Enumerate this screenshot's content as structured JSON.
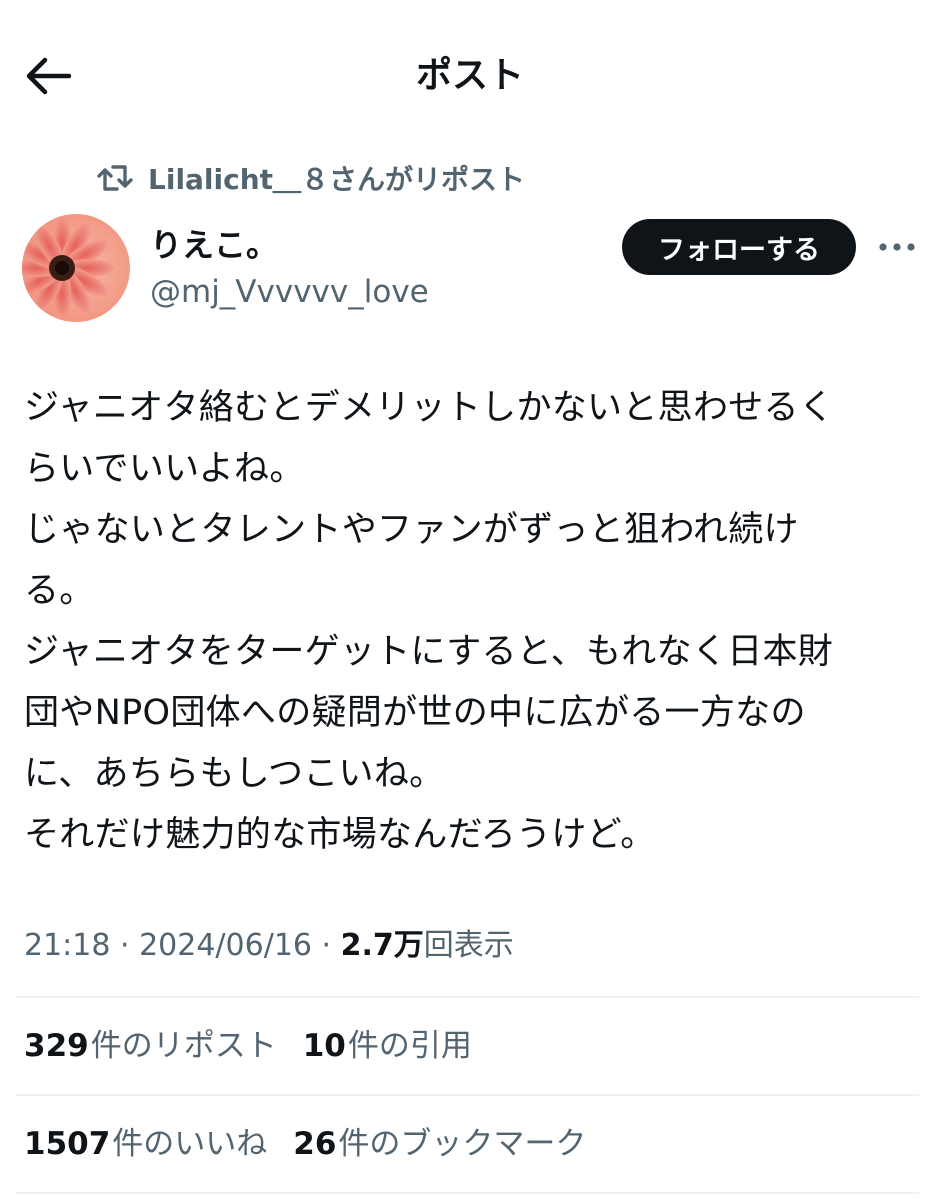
{
  "header": {
    "title": "ポスト",
    "back_icon": "arrow-left-icon"
  },
  "repost": {
    "icon": "retweet-icon",
    "text": "Lilalicht＿８さんがリポスト"
  },
  "author": {
    "display_name": "りえこ。",
    "handle": "@mj_Vvvvvv_love",
    "avatar_icon": "flower-avatar"
  },
  "actions": {
    "follow_label": "フォローする",
    "more_icon": "more-horizontal-icon"
  },
  "tweet": {
    "lines": [
      "ジャニオタ絡むとデメリットしかないと思わせるく",
      "らいでいいよね。",
      "じゃないとタレントやファンがずっと狙われ続け",
      "る。",
      "ジャニオタをターゲットにすると、もれなく日本財",
      "団やNPO団体への疑問が世の中に広がる一方なの",
      "に、あちらもしつこいね。",
      "それだけ魅力的な市場なんだろうけど。"
    ]
  },
  "meta": {
    "time": "21:18",
    "separator": " · ",
    "date": "2024/06/16",
    "views_count": "2.7万",
    "views_label": "回表示"
  },
  "stats": {
    "reposts": {
      "count": "329",
      "label": "件のリポスト"
    },
    "quotes": {
      "count": "10",
      "label": "件の引用"
    },
    "likes": {
      "count": "1507",
      "label": "件のいいね"
    },
    "bookmarks": {
      "count": "26",
      "label": "件のブックマーク"
    }
  },
  "colors": {
    "text_primary": "#0f1419",
    "text_secondary": "#536471",
    "divider": "#eff3f4",
    "follow_bg": "#0f1419"
  }
}
